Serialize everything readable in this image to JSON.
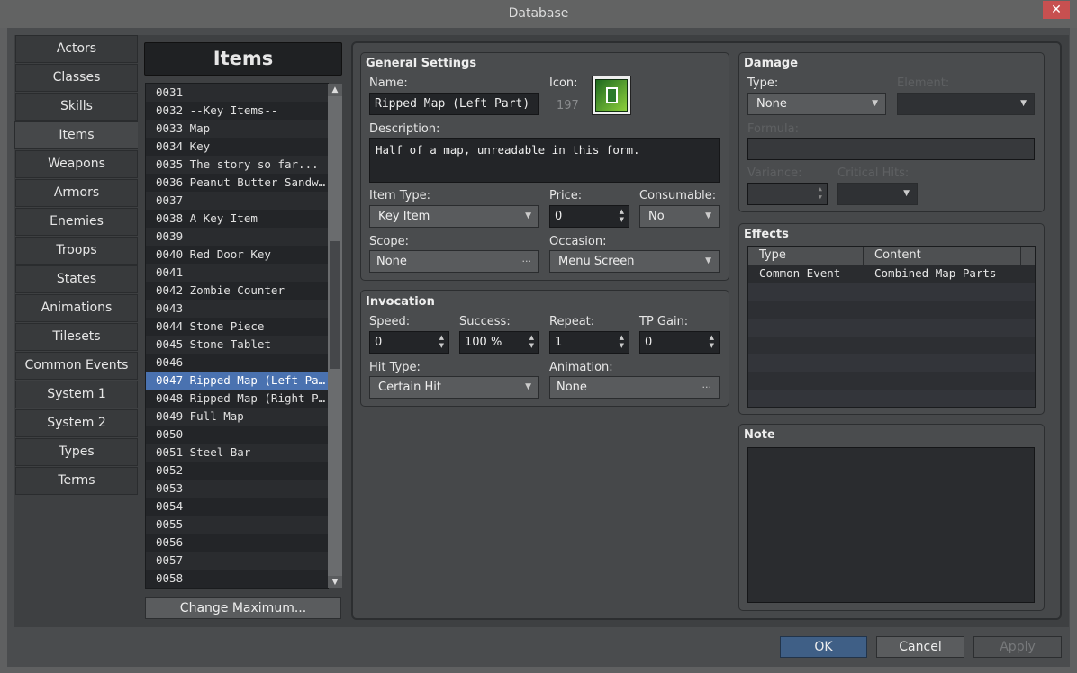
{
  "window": {
    "title": "Database",
    "close": "✕"
  },
  "tabs": [
    "Actors",
    "Classes",
    "Skills",
    "Items",
    "Weapons",
    "Armors",
    "Enemies",
    "Troops",
    "States",
    "Animations",
    "Tilesets",
    "Common Events",
    "System 1",
    "System 2",
    "Types",
    "Terms"
  ],
  "selected_tab": "Items",
  "list": {
    "title": "Items",
    "selected": "0047",
    "change_max": "Change Maximum...",
    "rows": [
      "0031",
      "0032 --Key Items--",
      "0033 Map",
      "0034 Key",
      "0035 The story so far...",
      "0036 Peanut Butter Sandw…",
      "0037",
      "0038 A Key Item",
      "0039",
      "0040 Red Door Key",
      "0041",
      "0042 Zombie Counter",
      "0043",
      "0044 Stone Piece",
      "0045 Stone Tablet",
      "0046",
      "0047 Ripped Map (Left Pa…",
      "0048 Ripped Map (Right P…",
      "0049 Full Map",
      "0050",
      "0051 Steel Bar",
      "0052",
      "0053",
      "0054",
      "0055",
      "0056",
      "0057",
      "0058"
    ]
  },
  "general": {
    "title": "General Settings",
    "name_label": "Name:",
    "name": "Ripped Map (Left Part)",
    "icon_label": "Icon:",
    "icon_index": "197",
    "desc_label": "Description:",
    "description": "Half of a map, unreadable in this form.",
    "item_type_label": "Item Type:",
    "item_type": "Key Item",
    "price_label": "Price:",
    "price": "0",
    "consumable_label": "Consumable:",
    "consumable": "No",
    "scope_label": "Scope:",
    "scope": "None",
    "occasion_label": "Occasion:",
    "occasion": "Menu Screen"
  },
  "invocation": {
    "title": "Invocation",
    "speed_label": "Speed:",
    "speed": "0",
    "success_label": "Success:",
    "success": "100 %",
    "repeat_label": "Repeat:",
    "repeat": "1",
    "tp_label": "TP Gain:",
    "tp": "0",
    "hit_label": "Hit Type:",
    "hit": "Certain Hit",
    "anim_label": "Animation:",
    "anim": "None"
  },
  "damage": {
    "title": "Damage",
    "type_label": "Type:",
    "type": "None",
    "element_label": "Element:",
    "formula_label": "Formula:",
    "variance_label": "Variance:",
    "critical_label": "Critical Hits:"
  },
  "effects": {
    "title": "Effects",
    "col_type": "Type",
    "col_content": "Content",
    "rows": [
      {
        "type": "Common Event",
        "content": "Combined Map Parts"
      }
    ]
  },
  "note": {
    "title": "Note"
  },
  "buttons": {
    "ok": "OK",
    "cancel": "Cancel",
    "apply": "Apply"
  }
}
